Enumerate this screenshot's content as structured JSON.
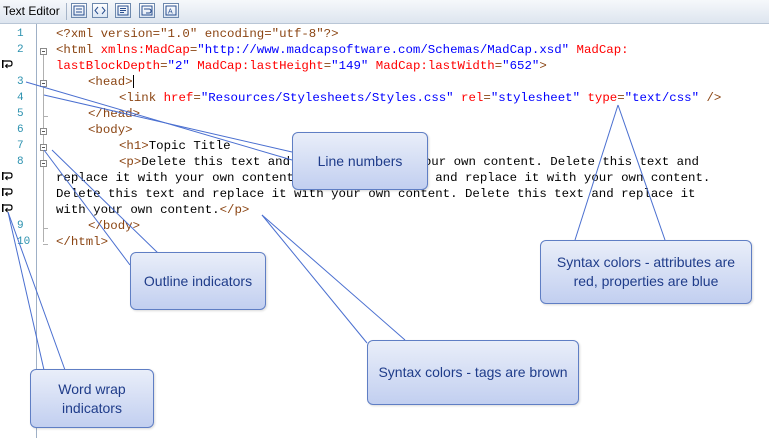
{
  "toolbar": {
    "title": "Text Editor",
    "buttons": [
      {
        "icon": "view-lines-icon"
      },
      {
        "icon": "tags-icon"
      },
      {
        "icon": "outline-icon"
      },
      {
        "icon": "word-wrap-icon"
      },
      {
        "icon": "text-format-icon"
      }
    ]
  },
  "line_numbers": [
    "1",
    "2",
    "3",
    "4",
    "5",
    "6",
    "7",
    "8",
    "9",
    "10"
  ],
  "code": {
    "l1": "<?xml version=\"1.0\" encoding=\"utf-8\"?>",
    "l2a_tag": "<html ",
    "l2a_attr1": "xmlns:MadCap",
    "l2a_eq1": "=",
    "l2a_val1": "\"http://www.madcapsoftware.com/Schemas/MadCap.xsd\"",
    "l2a_attr2": " MadCap:",
    "l2b_attr2": "lastBlockDepth",
    "l2b_eq2": "=",
    "l2b_val2": "\"2\"",
    "l2b_attr3": " MadCap:lastHeight",
    "l2b_eq3": "=",
    "l2b_val3": "\"149\"",
    "l2b_attr4": " MadCap:lastWidth",
    "l2b_eq4": "=",
    "l2b_val4": "\"652\"",
    "l2b_end": ">",
    "l3": "<head>",
    "l4_tag": "<link ",
    "l4_attr1": "href",
    "l4_eq1": "=",
    "l4_val1": "\"Resources/Stylesheets/Styles.css\"",
    "l4_attr2": " rel",
    "l4_eq2": "=",
    "l4_val2": "\"stylesheet\"",
    "l4_attr3": " type",
    "l4_eq3": "=",
    "l4_val3": "\"text/css\"",
    "l4_end": " />",
    "l5": "</head>",
    "l6": "<body>",
    "l7_tag": "<h1>",
    "l7_text": "Topic Title",
    "l8a_tag": "<p>",
    "l8a_text": "Delete this text and replace it with your own content. Delete this text and",
    "l8b": "replace it with your own content. Delete this text and replace it with your own content.",
    "l8c": "Delete this text and replace it with your own content. Delete this text and replace it",
    "l8d_text": "with your own content.",
    "l8d_tag": "</p>",
    "l9": "</body>",
    "l10": "</html>"
  },
  "callouts": {
    "line_numbers": "Line numbers",
    "outline": "Outline indicators",
    "syntax_attr_line1": "Syntax colors - attributes are",
    "syntax_attr_line2": "red, properties are blue",
    "syntax_tags": "Syntax colors - tags are brown",
    "word_wrap_line1": "Word wrap",
    "word_wrap_line2": "indicators"
  },
  "colors": {
    "tag": "#8b4513",
    "attribute": "#ff0000",
    "value": "#0000ff",
    "line_number": "#2b91af",
    "callout_border": "#5f7ec4",
    "callout_text": "#1f3c8a"
  }
}
